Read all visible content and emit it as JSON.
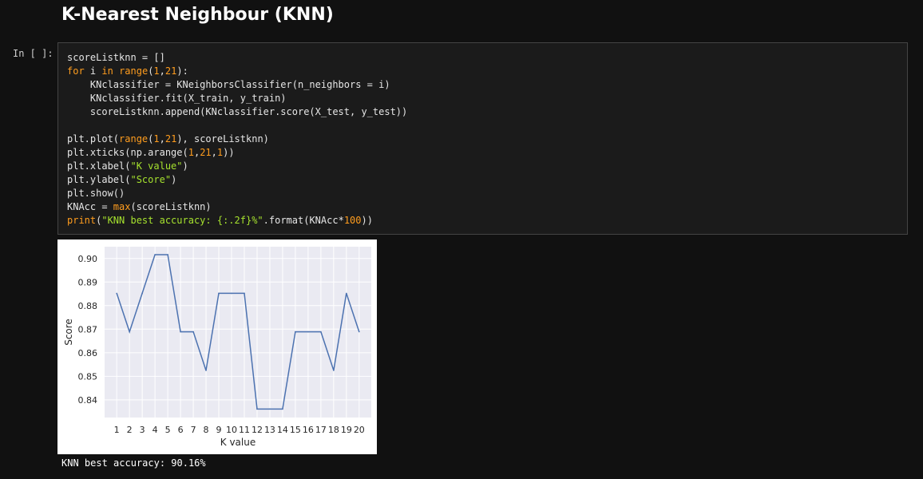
{
  "notebook": {
    "heading": "K-Nearest Neighbour (KNN)",
    "prompt": "In [ ]:",
    "output_text": "KNN best accuracy: 90.16%"
  },
  "code_lines": [
    [
      {
        "t": "scoreListknn = []",
        "c": ""
      }
    ],
    [
      {
        "t": "for",
        "c": "kw"
      },
      {
        "t": " i ",
        "c": ""
      },
      {
        "t": "in",
        "c": "kw"
      },
      {
        "t": " ",
        "c": ""
      },
      {
        "t": "range",
        "c": "bi"
      },
      {
        "t": "(",
        "c": ""
      },
      {
        "t": "1",
        "c": "num"
      },
      {
        "t": ",",
        "c": ""
      },
      {
        "t": "21",
        "c": "num"
      },
      {
        "t": "):",
        "c": ""
      }
    ],
    [
      {
        "t": "    KNclassifier = KNeighborsClassifier(n_neighbors = i)",
        "c": ""
      }
    ],
    [
      {
        "t": "    KNclassifier.fit(X_train, y_train)",
        "c": ""
      }
    ],
    [
      {
        "t": "    scoreListknn.append(KNclassifier.score(X_test, y_test))",
        "c": ""
      }
    ],
    [
      {
        "t": "",
        "c": ""
      }
    ],
    [
      {
        "t": "plt.plot(",
        "c": ""
      },
      {
        "t": "range",
        "c": "bi"
      },
      {
        "t": "(",
        "c": ""
      },
      {
        "t": "1",
        "c": "num"
      },
      {
        "t": ",",
        "c": ""
      },
      {
        "t": "21",
        "c": "num"
      },
      {
        "t": "), scoreListknn)",
        "c": ""
      }
    ],
    [
      {
        "t": "plt.xticks(np.arange(",
        "c": ""
      },
      {
        "t": "1",
        "c": "num"
      },
      {
        "t": ",",
        "c": ""
      },
      {
        "t": "21",
        "c": "num"
      },
      {
        "t": ",",
        "c": ""
      },
      {
        "t": "1",
        "c": "num"
      },
      {
        "t": "))",
        "c": ""
      }
    ],
    [
      {
        "t": "plt.xlabel(",
        "c": ""
      },
      {
        "t": "\"K value\"",
        "c": "str"
      },
      {
        "t": ")",
        "c": ""
      }
    ],
    [
      {
        "t": "plt.ylabel(",
        "c": ""
      },
      {
        "t": "\"Score\"",
        "c": "str"
      },
      {
        "t": ")",
        "c": ""
      }
    ],
    [
      {
        "t": "plt.show()",
        "c": ""
      }
    ],
    [
      {
        "t": "KNAcc = ",
        "c": ""
      },
      {
        "t": "max",
        "c": "bi"
      },
      {
        "t": "(scoreListknn)",
        "c": ""
      }
    ],
    [
      {
        "t": "print",
        "c": "bi"
      },
      {
        "t": "(",
        "c": ""
      },
      {
        "t": "\"KNN best accuracy: {:.2f}%\"",
        "c": "str"
      },
      {
        "t": ".format(KNAcc*",
        "c": ""
      },
      {
        "t": "100",
        "c": "num"
      },
      {
        "t": "))",
        "c": ""
      }
    ]
  ],
  "colors": {
    "keyword": "#ff9d1e",
    "string": "#a6e22e",
    "line": "#4c72b0",
    "plot_bg": "#eaeaf2"
  },
  "chart_data": {
    "type": "line",
    "xlabel": "K value",
    "ylabel": "Score",
    "x": [
      1,
      2,
      3,
      4,
      5,
      6,
      7,
      8,
      9,
      10,
      11,
      12,
      13,
      14,
      15,
      16,
      17,
      18,
      19,
      20
    ],
    "series": [
      {
        "values": [
          0.8852,
          0.8689,
          0.8852,
          0.9016,
          0.9016,
          0.8689,
          0.8689,
          0.8525,
          0.8852,
          0.8852,
          0.8852,
          0.8361,
          0.8361,
          0.8361,
          0.8689,
          0.8689,
          0.8689,
          0.8525,
          0.8852,
          0.8689
        ]
      }
    ],
    "yticks": [
      "0.84",
      "0.85",
      "0.86",
      "0.87",
      "0.88",
      "0.89",
      "0.90"
    ],
    "ylim": [
      0.8325,
      0.905
    ],
    "xlim": [
      0.05,
      20.95
    ],
    "grid": true,
    "style": "seaborn-darkgrid"
  }
}
